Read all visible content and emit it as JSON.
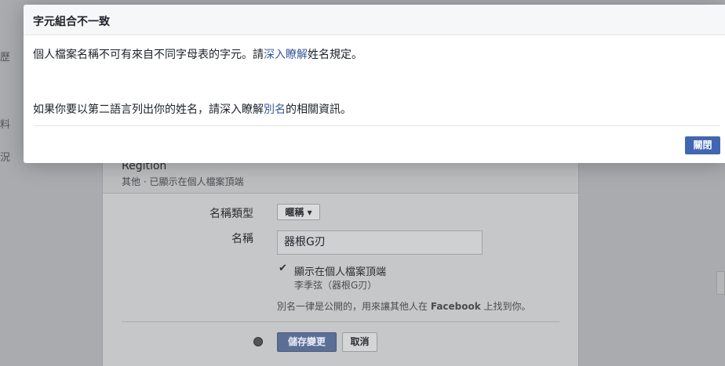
{
  "background": {
    "sidebar_fragments": [
      "歷",
      "料",
      "況"
    ],
    "entry_title": "Regition",
    "entry_subtitle": "其他 · 已顯示在個人檔案頂端",
    "name_type_label": "名稱類型",
    "name_type_value": "暱稱",
    "name_label": "名稱",
    "name_value": "器根G刃",
    "show_on_profile_label": "顯示在個人檔案頂端",
    "show_on_profile_preview": "李季弦（器根G刃）",
    "notice_before": "別名一律是公開的，用來讓其他人在 ",
    "notice_brand": "Facebook",
    "notice_after": " 上找到你。",
    "save_label": "儲存變更",
    "cancel_label": "取消"
  },
  "dialog": {
    "title": "字元組合不一致",
    "p1_text": "個人檔案名稱不可有來自不同字母表的字元。請",
    "p1_link": "深入瞭解",
    "p1_after": "姓名規定。",
    "p2_text": "如果你要以第二語言列出你的姓名，請深入瞭解",
    "p2_link": "別名",
    "p2_after": "的相關資訊。",
    "close_label": "關閉"
  },
  "colors": {
    "overlay_bg": "#a9abae",
    "link": "#365899",
    "primary_button": "#4267b2"
  },
  "icons": {
    "dropdown": "caret-down-icon",
    "checkbox": "checkmark-icon",
    "privacy": "globe-icon"
  }
}
